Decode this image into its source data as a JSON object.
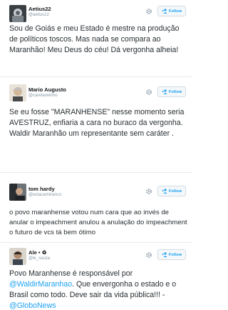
{
  "colors": {
    "link": "#1da1f2",
    "text": "#292f33",
    "handle": "#8899a6",
    "border": "#e6ecf0"
  },
  "tweets": [
    {
      "name": "Aetius22",
      "handle": "@aetius22",
      "follow_label": "Follow",
      "text": "Sou de Goiás e meu Estado é mestre na produção de políticos toscos. Mas nada se compara ao Maranhão! Meu Deus do céu! Dá vergonha alheia!"
    },
    {
      "name": "Mario Augusto",
      "handle": "@caretavelnho",
      "follow_label": "Follow",
      "text": "Se eu fosse \"MARANHENSE\" nesse momento seria AVESTRUZ, enfiaria a cara no buraco da vergonha. Waldir Maranhão um representante sem caráter ."
    },
    {
      "name": "tom hardy",
      "handle": "@estacaminanco",
      "follow_label": "Follow",
      "text": "o povo maranhense votou num cara que ao invés de anular o impeachment anulou a anulação do impeachment o futuro de vcs tá bem ótimo"
    },
    {
      "name": "Ale • ♻",
      "handle": "@le_souza",
      "follow_label": "Follow",
      "text_before": "Povo Maranhense é responsável por ",
      "mention": "@WaldirMaranhao",
      "text_middle": ". Que envergonha o estado e o Brasil como todo. Deve sair da vida pública!!! - ",
      "mention2": "@GloboNews"
    }
  ]
}
